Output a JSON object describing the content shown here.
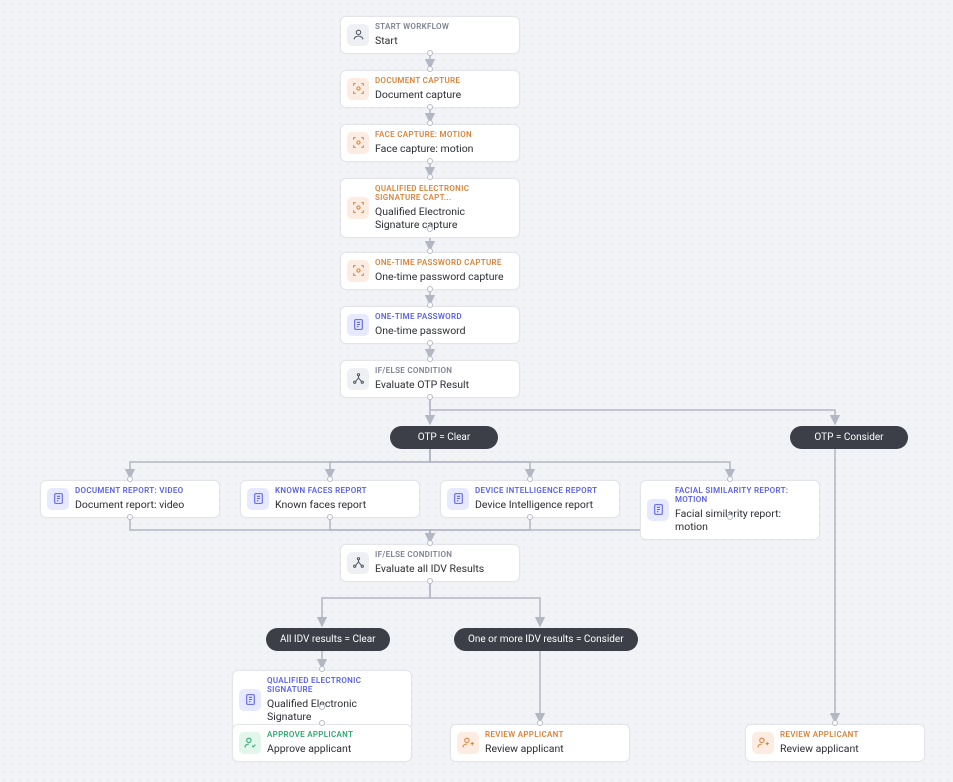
{
  "nodes": {
    "start": {
      "cat": "START WORKFLOW",
      "title": "Start"
    },
    "docCapture": {
      "cat": "DOCUMENT CAPTURE",
      "title": "Document capture"
    },
    "faceCapture": {
      "cat": "FACE CAPTURE: MOTION",
      "title": "Face capture: motion"
    },
    "qesCapture": {
      "cat": "QUALIFIED ELECTRONIC SIGNATURE CAPT...",
      "title": "Qualified Electronic Signature capture"
    },
    "otpCapture": {
      "cat": "ONE-TIME PASSWORD CAPTURE",
      "title": "One-time password capture"
    },
    "otp": {
      "cat": "ONE-TIME PASSWORD",
      "title": "One-time password"
    },
    "evalOtp": {
      "cat": "IF/ELSE CONDITION",
      "title": "Evaluate OTP Result"
    },
    "docReport": {
      "cat": "DOCUMENT REPORT: VIDEO",
      "title": "Document report: video"
    },
    "knownFaces": {
      "cat": "KNOWN FACES REPORT",
      "title": "Known faces report"
    },
    "devIntel": {
      "cat": "DEVICE INTELLIGENCE REPORT",
      "title": "Device Intelligence report"
    },
    "facialSim": {
      "cat": "FACIAL SIMILARITY REPORT: MOTION",
      "title": "Facial similarity report: motion"
    },
    "evalIdv": {
      "cat": "IF/ELSE CONDITION",
      "title": "Evaluate all IDV Results"
    },
    "qes": {
      "cat": "QUALIFIED ELECTRONIC SIGNATURE",
      "title": "Qualified Electronic Signature"
    },
    "approve": {
      "cat": "APPROVE APPLICANT",
      "title": "Approve applicant"
    },
    "review1": {
      "cat": "REVIEW APPLICANT",
      "title": "Review applicant"
    },
    "review2": {
      "cat": "REVIEW APPLICANT",
      "title": "Review applicant"
    }
  },
  "pills": {
    "otpClear": "OTP = Clear",
    "otpConsider": "OTP = Consider",
    "idvClear": "All IDV results = Clear",
    "idvConsider": "One or more IDV results = Consider"
  },
  "chart_data": {
    "type": "flowchart",
    "nodes": [
      {
        "id": "start",
        "kind": "start",
        "label": "Start"
      },
      {
        "id": "docCapture",
        "kind": "task",
        "label": "Document capture"
      },
      {
        "id": "faceCapture",
        "kind": "task",
        "label": "Face capture: motion"
      },
      {
        "id": "qesCapture",
        "kind": "task",
        "label": "Qualified Electronic Signature capture"
      },
      {
        "id": "otpCapture",
        "kind": "task",
        "label": "One-time password capture"
      },
      {
        "id": "otp",
        "kind": "task",
        "label": "One-time password"
      },
      {
        "id": "evalOtp",
        "kind": "condition",
        "label": "Evaluate OTP Result"
      },
      {
        "id": "docReport",
        "kind": "task",
        "label": "Document report: video"
      },
      {
        "id": "knownFaces",
        "kind": "task",
        "label": "Known faces report"
      },
      {
        "id": "devIntel",
        "kind": "task",
        "label": "Device Intelligence report"
      },
      {
        "id": "facialSim",
        "kind": "task",
        "label": "Facial similarity report: motion"
      },
      {
        "id": "evalIdv",
        "kind": "condition",
        "label": "Evaluate all IDV Results"
      },
      {
        "id": "qes",
        "kind": "task",
        "label": "Qualified Electronic Signature"
      },
      {
        "id": "approve",
        "kind": "end",
        "label": "Approve applicant"
      },
      {
        "id": "review1",
        "kind": "end",
        "label": "Review applicant"
      },
      {
        "id": "review2",
        "kind": "end",
        "label": "Review applicant"
      }
    ],
    "edges": [
      {
        "from": "start",
        "to": "docCapture"
      },
      {
        "from": "docCapture",
        "to": "faceCapture"
      },
      {
        "from": "faceCapture",
        "to": "qesCapture"
      },
      {
        "from": "qesCapture",
        "to": "otpCapture"
      },
      {
        "from": "otpCapture",
        "to": "otp"
      },
      {
        "from": "otp",
        "to": "evalOtp"
      },
      {
        "from": "evalOtp",
        "to": "docReport",
        "label": "OTP = Clear"
      },
      {
        "from": "evalOtp",
        "to": "knownFaces",
        "label": "OTP = Clear"
      },
      {
        "from": "evalOtp",
        "to": "devIntel",
        "label": "OTP = Clear"
      },
      {
        "from": "evalOtp",
        "to": "facialSim",
        "label": "OTP = Clear"
      },
      {
        "from": "evalOtp",
        "to": "review2",
        "label": "OTP = Consider"
      },
      {
        "from": "docReport",
        "to": "evalIdv"
      },
      {
        "from": "knownFaces",
        "to": "evalIdv"
      },
      {
        "from": "devIntel",
        "to": "evalIdv"
      },
      {
        "from": "facialSim",
        "to": "evalIdv"
      },
      {
        "from": "evalIdv",
        "to": "qes",
        "label": "All IDV results = Clear"
      },
      {
        "from": "evalIdv",
        "to": "review1",
        "label": "One or more IDV results = Consider"
      },
      {
        "from": "qes",
        "to": "approve"
      }
    ]
  }
}
